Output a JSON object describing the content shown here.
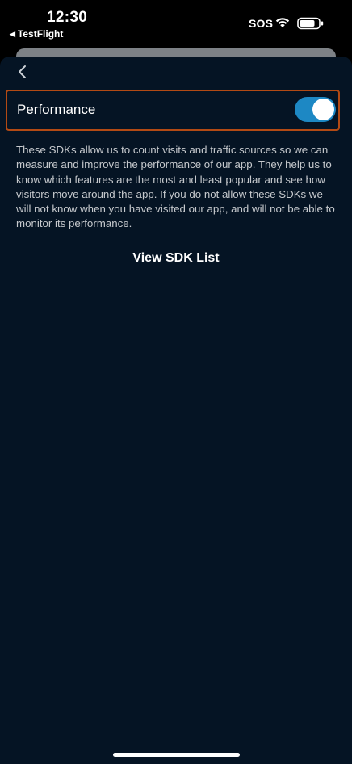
{
  "status_bar": {
    "time": "12:30",
    "back_app": "TestFlight",
    "back_app_icon": "back-triangle-icon",
    "carrier": "SOS",
    "wifi_icon": "wifi-icon",
    "battery_icon": "battery-icon"
  },
  "header": {
    "back_icon": "chevron-left-icon"
  },
  "performance": {
    "label": "Performance",
    "enabled": true,
    "toggle_color": "#1d88c4",
    "highlight_color": "#b34a14"
  },
  "description": "These SDKs allow us to count visits and traffic sources so we can measure and improve the performance of our app. They help us to know which features are the most and least popular and see how visitors move around the app. If you do not allow these SDKs we will not know when you have visited our app, and will not be able to monitor its performance.",
  "actions": {
    "view_sdk_list": "View SDK List"
  },
  "colors": {
    "background": "#051424",
    "text_secondary": "#c6c9cd"
  }
}
